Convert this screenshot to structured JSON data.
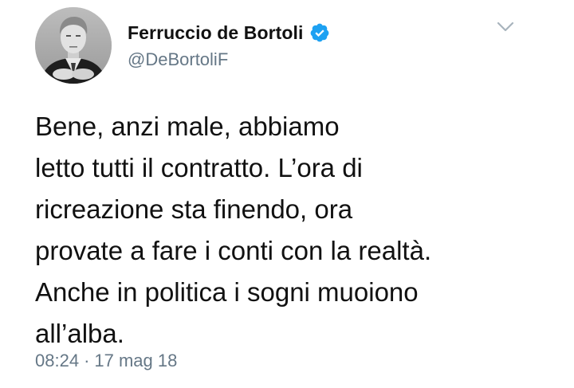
{
  "tweet": {
    "author": {
      "display_name": "Ferruccio de Bortoli",
      "handle": "@DeBortoliF",
      "verified": true,
      "avatar": "grayscale-portrait"
    },
    "text": "Bene, anzi male, abbiamo\nletto tutti il contratto. L’ora di\nricreazione sta finendo, ora\nprovate a fare i conti con la realtà.\nAnche in politica i sogni muoiono\nall’alba.",
    "time": "08:24",
    "separator": "·",
    "date": "17 mag 18",
    "icons": {
      "verified": "verified-badge-icon",
      "menu": "chevron-down-icon"
    },
    "colors": {
      "verified_blue": "#1da1f2",
      "secondary_text": "#657786",
      "primary_text": "#111111"
    }
  }
}
